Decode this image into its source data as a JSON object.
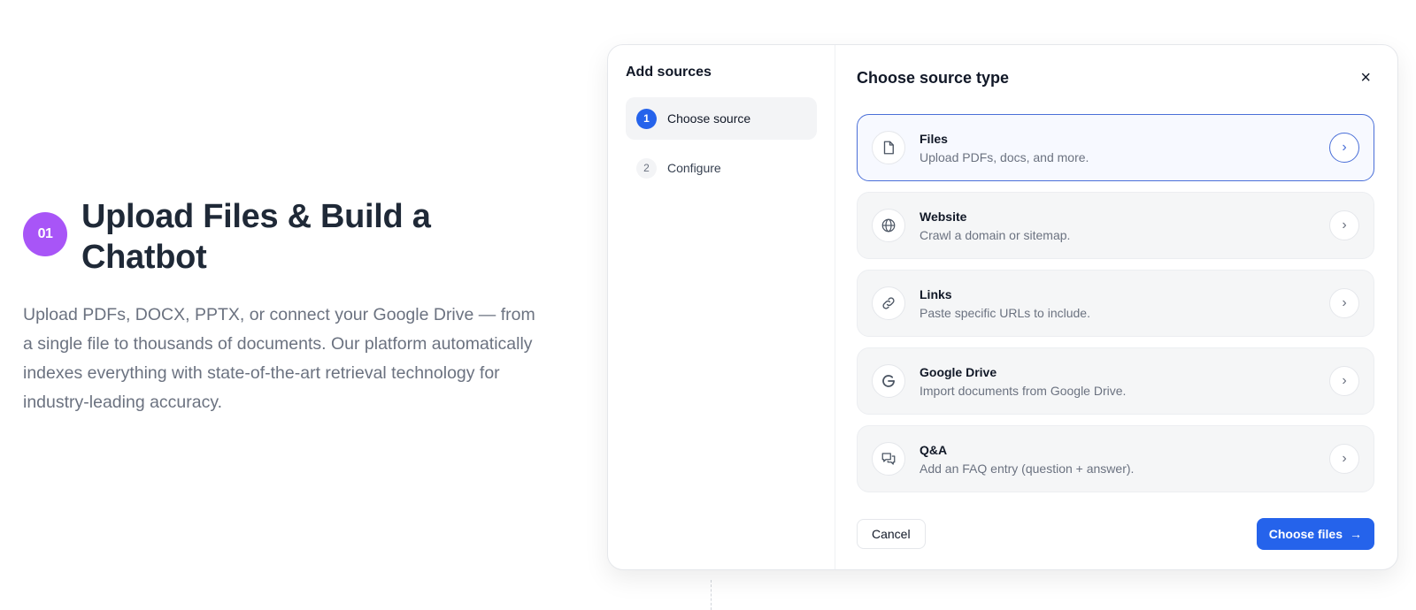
{
  "intro": {
    "step_badge": "01",
    "title": "Upload Files & Build a Chatbot",
    "description": "Upload PDFs, DOCX, PPTX, or connect your Google Drive — from a single file to thousands of documents. Our platform automatically indexes everything with state-of-the-art retrieval technology for industry-leading accuracy."
  },
  "modal": {
    "sidebar_title": "Add sources",
    "steps": [
      {
        "number": "1",
        "label": "Choose source",
        "active": true
      },
      {
        "number": "2",
        "label": "Configure",
        "active": false
      }
    ],
    "main_title": "Choose source type",
    "close_label": "×",
    "sources": [
      {
        "title": "Files",
        "description": "Upload PDFs, docs, and more.",
        "icon": "file-icon",
        "selected": true
      },
      {
        "title": "Website",
        "description": "Crawl a domain or sitemap.",
        "icon": "globe-icon",
        "selected": false
      },
      {
        "title": "Links",
        "description": "Paste specific URLs to include.",
        "icon": "link-icon",
        "selected": false
      },
      {
        "title": "Google Drive",
        "description": "Import documents from Google Drive.",
        "icon": "google-icon",
        "selected": false
      },
      {
        "title": "Q&A",
        "description": "Add an FAQ entry (question + answer).",
        "icon": "chat-icon",
        "selected": false
      }
    ],
    "cancel_label": "Cancel",
    "primary_label": "Choose files"
  },
  "colors": {
    "badge": "#a855f7",
    "accent": "#2563eb",
    "selected_border": "#4a6fd8"
  }
}
